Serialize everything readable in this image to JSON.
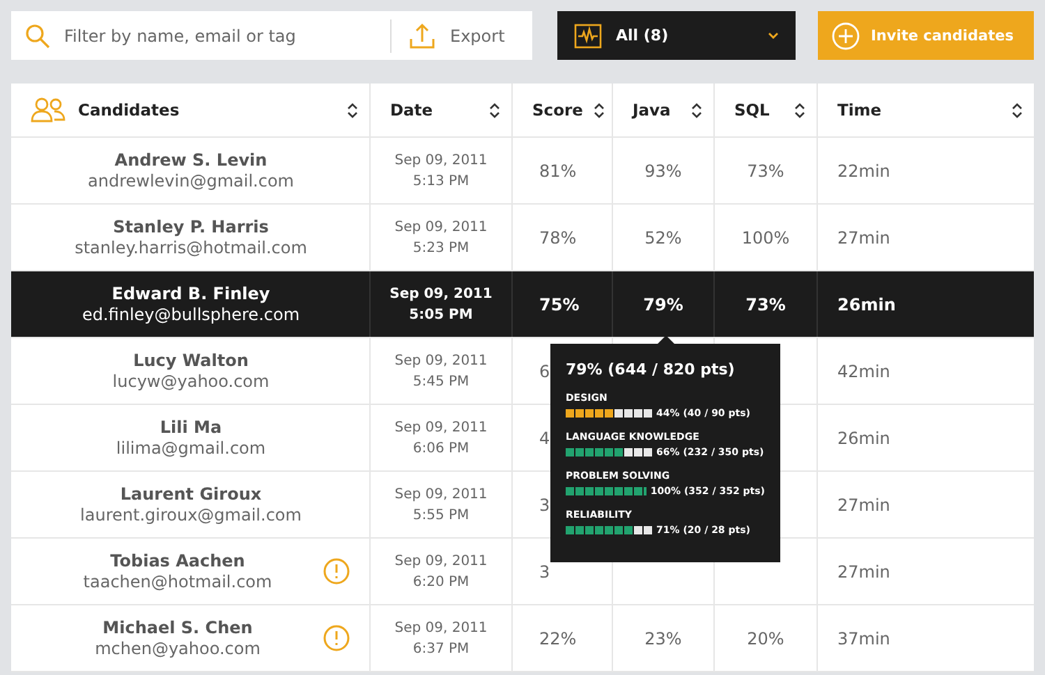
{
  "toolbar": {
    "search": {
      "placeholder": "Filter by name, email or tag"
    },
    "export": "Export",
    "filter": {
      "label": "All (8)"
    },
    "invite": "Invite candidates"
  },
  "table": {
    "columns": [
      {
        "label": "Candidates"
      },
      {
        "label": "Date"
      },
      {
        "label": "Score"
      },
      {
        "label": "Java"
      },
      {
        "label": "SQL"
      },
      {
        "label": "Time"
      }
    ],
    "rows": [
      {
        "name": "Andrew S. Levin",
        "email": "andrewlevin@gmail.com",
        "date": "Sep 09, 2011",
        "time_of_day": "5:13 PM",
        "score": "81%",
        "java": "93%",
        "sql": "73%",
        "time": "22min",
        "selected": false,
        "warning": false
      },
      {
        "name": "Stanley P. Harris",
        "email": "stanley.harris@hotmail.com",
        "date": "Sep 09, 2011",
        "time_of_day": "5:23 PM",
        "score": "78%",
        "java": "52%",
        "sql": "100%",
        "time": "27min",
        "selected": false,
        "warning": false
      },
      {
        "name": "Edward B. Finley",
        "email": "ed.finley@bullsphere.com",
        "date": "Sep 09, 2011",
        "time_of_day": "5:05 PM",
        "score": "75%",
        "java": "79%",
        "sql": "73%",
        "time": "26min",
        "selected": true,
        "warning": false
      },
      {
        "name": "Lucy Walton",
        "email": "lucyw@yahoo.com",
        "date": "Sep 09, 2011",
        "time_of_day": "5:45 PM",
        "score": "6",
        "time": "42min",
        "selected": false,
        "warning": false
      },
      {
        "name": "Lili Ma",
        "email": "lilima@gmail.com",
        "date": "Sep 09, 2011",
        "time_of_day": "6:06 PM",
        "score": "4",
        "time": "26min",
        "selected": false,
        "warning": false
      },
      {
        "name": "Laurent Giroux",
        "email": "laurent.giroux@gmail.com",
        "date": "Sep 09, 2011",
        "time_of_day": "5:55 PM",
        "score": "3",
        "time": "27min",
        "selected": false,
        "warning": false
      },
      {
        "name": "Tobias Aachen",
        "email": "taachen@hotmail.com",
        "date": "Sep 09, 2011",
        "time_of_day": "6:20 PM",
        "score": "3",
        "time": "27min",
        "selected": false,
        "warning": true
      },
      {
        "name": "Michael S. Chen",
        "email": "mchen@yahoo.com",
        "date": "Sep 09, 2011",
        "time_of_day": "6:37 PM",
        "score": "22%",
        "java": "23%",
        "sql": "20%",
        "time": "37min",
        "selected": false,
        "warning": true
      }
    ]
  },
  "tooltip": {
    "title": "79% (644 / 820 pts)",
    "sections": [
      {
        "label": "DESIGN",
        "level": 0.56,
        "color": "#eea71d",
        "reading": "44% (40 / 90 pts)"
      },
      {
        "label": "LANGUAGE KNOWLEDGE",
        "level": 0.67,
        "color": "#22a36f",
        "reading": "66% (232 / 350 pts)"
      },
      {
        "label": "PROBLEM SOLVING",
        "level": 1,
        "color": "#22a36f",
        "reading": "100% (352 / 352 pts)"
      },
      {
        "label": "RELIABILITY",
        "level": 0.78,
        "color": "#22a36f",
        "reading": "71% (20 / 28 pts)"
      }
    ]
  }
}
